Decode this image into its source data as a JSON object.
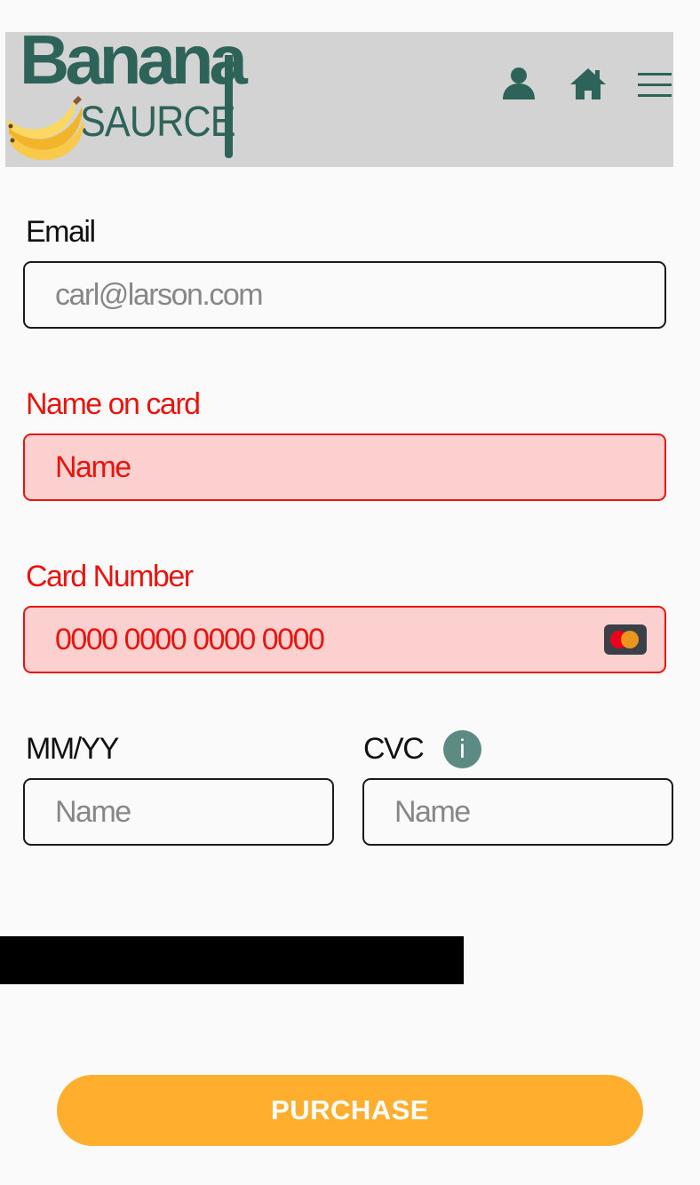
{
  "header": {
    "logo_line_1": "Banana",
    "logo_line_2": "SAURCE",
    "icons": [
      "user-icon",
      "home-icon",
      "menu-icon"
    ]
  },
  "form": {
    "email": {
      "label": "Email",
      "placeholder": "carl@larson.com",
      "value": ""
    },
    "name_on_card": {
      "label": "Name on card",
      "placeholder": "Name",
      "value": "",
      "state": "error"
    },
    "card_number": {
      "label": "Card Number",
      "placeholder": "0000 0000 0000 0000",
      "value": "",
      "state": "error",
      "brand_icon": "mastercard-icon"
    },
    "expiry": {
      "label": "MM/YY",
      "placeholder": "Name",
      "value": ""
    },
    "cvc": {
      "label": "CVC",
      "placeholder": "Name",
      "value": "",
      "info_glyph": "i"
    },
    "purchase_label": "PURCHASE"
  },
  "colors": {
    "brand_green": "#2d6358",
    "header_bg": "#d3d3d3",
    "error_red": "#e8150f",
    "error_bg": "#fdd0d0",
    "button_orange": "#ffaf2d",
    "info_icon_bg": "#5e8a84"
  }
}
